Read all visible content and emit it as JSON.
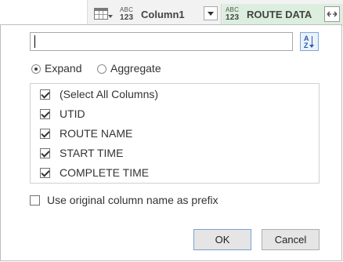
{
  "header": {
    "column1": {
      "type_badge_top": "ABC",
      "type_badge_bottom": "123",
      "name": "Column1"
    },
    "column2": {
      "type_badge_top": "ABC",
      "type_badge_bottom": "123",
      "name": "ROUTE DATA"
    }
  },
  "popup": {
    "search": {
      "value": "",
      "placeholder": ""
    },
    "sort_icon": {
      "top": "A",
      "bottom": "Z"
    },
    "mode_options": [
      {
        "label": "Expand",
        "selected": true
      },
      {
        "label": "Aggregate",
        "selected": false
      }
    ],
    "columns": [
      {
        "label": "(Select All Columns)",
        "checked": true
      },
      {
        "label": "UTID",
        "checked": true
      },
      {
        "label": "ROUTE NAME",
        "checked": true
      },
      {
        "label": "START TIME",
        "checked": true
      },
      {
        "label": "COMPLETE TIME",
        "checked": true
      }
    ],
    "use_prefix": {
      "label": "Use original column name as prefix",
      "checked": false
    },
    "ok_label": "OK",
    "cancel_label": "Cancel"
  },
  "colors": {
    "accent_border": "#7aa7d9",
    "active_column_bg": "#dceedd"
  }
}
